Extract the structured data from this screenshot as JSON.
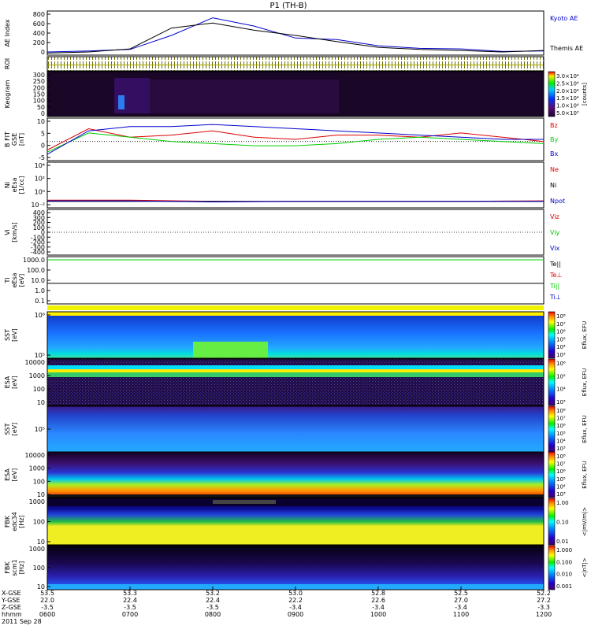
{
  "title": "P1 (TH-B)",
  "colors": {
    "frame": "#000000",
    "black": "#000000",
    "red": "#dd0000",
    "green": "#00cc00",
    "blue": "#0000cc",
    "yellow": "#f2f200",
    "navy": "#00007a"
  },
  "panels": [
    {
      "name": "ae-index",
      "ylabel": [
        "AE Index"
      ],
      "ticks": [
        "800",
        "600",
        "400",
        "200",
        "0"
      ],
      "right": [
        {
          "text": "Kyoto AE",
          "color": "blue"
        },
        {
          "text": "Themis AE",
          "color": "black"
        }
      ]
    },
    {
      "name": "roi",
      "ylabel": [
        "ROI"
      ],
      "ticks": [],
      "right": []
    },
    {
      "name": "keogram",
      "ylabel": [
        "Keogram"
      ],
      "ticks": [
        "300",
        "250",
        "200",
        "150",
        "100",
        "50",
        "0"
      ],
      "right": []
    },
    {
      "name": "b-fit",
      "ylabel": [
        "B FIT",
        "GSE",
        "[nT]"
      ],
      "ticks": [
        "10",
        "5",
        "0",
        "-5"
      ],
      "right": [
        {
          "text": "Bz",
          "color": "red"
        },
        {
          "text": "By",
          "color": "green"
        },
        {
          "text": "Bx",
          "color": "blue"
        }
      ]
    },
    {
      "name": "density",
      "ylabel": [
        "Ni",
        "eEsa",
        "[1/cc]"
      ],
      "ticks": [
        "10⁴",
        "10²",
        "10⁰",
        "10⁻²"
      ],
      "right": [
        {
          "text": "Ne",
          "color": "red"
        },
        {
          "text": "Ni",
          "color": "black"
        },
        {
          "text": "Npot",
          "color": "blue"
        }
      ]
    },
    {
      "name": "velocity",
      "ylabel": [
        "Vi",
        "[km/s]"
      ],
      "ticks": [
        "400",
        "300",
        "200",
        "100",
        "0",
        "-100",
        "-200",
        "-300",
        "-400"
      ],
      "right": [
        {
          "text": "Viz",
          "color": "red"
        },
        {
          "text": "Viy",
          "color": "green"
        },
        {
          "text": "Vix",
          "color": "blue"
        }
      ]
    },
    {
      "name": "temperature",
      "ylabel": [
        "Ti",
        "eEsa",
        "[eV]"
      ],
      "ticks": [
        "1000.0",
        "100.0",
        "10.0",
        "1.0",
        "0.1"
      ],
      "right": [
        {
          "text": "Te||",
          "color": "black"
        },
        {
          "text": "Te⊥",
          "color": "red"
        },
        {
          "text": "Ti||",
          "color": "green"
        },
        {
          "text": "Ti⊥",
          "color": "blue"
        }
      ]
    },
    {
      "name": "sst-ion",
      "ylabel": [
        "SST",
        "[eV]"
      ],
      "ticks": [
        "10⁶",
        "10⁵"
      ],
      "right": []
    },
    {
      "name": "esa-ion",
      "ylabel": [
        "ESA",
        "[eV]"
      ],
      "ticks": [
        "10000",
        "1000",
        "100",
        "10"
      ],
      "right": []
    },
    {
      "name": "sst-elec",
      "ylabel": [
        "SST",
        "[eV]"
      ],
      "ticks": [
        "10⁵"
      ],
      "right": []
    },
    {
      "name": "esa-elec",
      "ylabel": [
        "ESA",
        "[eV]"
      ],
      "ticks": [
        "10000",
        "1000",
        "100",
        "10"
      ],
      "right": []
    },
    {
      "name": "fbk-edc34",
      "ylabel": [
        "FBK",
        "edc34",
        "[Hz]"
      ],
      "ticks": [
        "1000",
        "100",
        "10"
      ],
      "right": []
    },
    {
      "name": "fbk-scm",
      "ylabel": [
        "FBK",
        "scm1",
        "[Hz]"
      ],
      "ticks": [
        "1000",
        "100",
        "10"
      ],
      "right": []
    }
  ],
  "colorbars": [
    {
      "name": "keogram-colorbar",
      "ticks": [
        "3.0×10⁴",
        "2.5×10⁴",
        "2.0×10⁴",
        "1.5×10⁴",
        "1.0×10⁴",
        "5.0×10³"
      ],
      "unit": "[counts]"
    },
    {
      "name": "sst-ion-colorbar",
      "ticks": [
        "10⁸",
        "10⁷",
        "10⁶",
        "10⁵",
        "10⁴",
        "10³"
      ],
      "unit": "Eflux, EFU"
    },
    {
      "name": "esa-ion-colorbar",
      "ticks": [
        "10⁶",
        "10⁵",
        "10⁴",
        "10³"
      ],
      "unit": "Eflux, EFU"
    },
    {
      "name": "sst-elec-colorbar",
      "ticks": [
        "10⁸",
        "10⁷",
        "10⁶",
        "10⁵",
        "10⁴",
        "10³"
      ],
      "unit": "Eflux, EFU"
    },
    {
      "name": "esa-elec-colorbar",
      "ticks": [
        "10⁸",
        "10⁷",
        "10⁶",
        "10⁵",
        "10⁴",
        "10³"
      ],
      "unit": "Eflux, EFU"
    },
    {
      "name": "fbk-edc34-colorbar",
      "ticks": [
        "1.00",
        "0.10",
        "0.01"
      ],
      "unit": "<|mV/m|>"
    },
    {
      "name": "fbk-scm-colorbar",
      "ticks": [
        "1.000",
        "0.100",
        "0.010",
        "0.001"
      ],
      "unit": "<|nT|>"
    }
  ],
  "xaxis": {
    "rowlabels": [
      "X-GSE",
      "Y-GSE",
      "Z-GSE",
      "hhmm",
      "2011 Sep 28"
    ],
    "columns": [
      {
        "x": "53.5",
        "y": "22.0",
        "z": "-3.5",
        "t": "0600"
      },
      {
        "x": "53.3",
        "y": "22.4",
        "z": "-3.5",
        "t": "0700"
      },
      {
        "x": "53.2",
        "y": "22.4",
        "z": "-3.5",
        "t": "0800"
      },
      {
        "x": "53.0",
        "y": "22.2",
        "z": "-3.4",
        "t": "0900"
      },
      {
        "x": "52.8",
        "y": "22.6",
        "z": "-3.4",
        "t": "1000"
      },
      {
        "x": "52.5",
        "y": "27.0",
        "z": "-3.4",
        "t": "1100"
      },
      {
        "x": "52.2",
        "y": "27.2",
        "z": "-3.3",
        "t": "1200"
      }
    ]
  },
  "chart_data": [
    {
      "type": "line",
      "title": "P1 (TH-B)",
      "ylabel": "AE Index",
      "ylim": [
        0,
        850
      ],
      "x": [
        "0600",
        "0630",
        "0700",
        "0730",
        "0800",
        "0830",
        "0900",
        "0930",
        "1000",
        "1030",
        "1100",
        "1130",
        "1200"
      ],
      "series": [
        {
          "name": "Kyoto AE",
          "values": [
            60,
            80,
            110,
            380,
            720,
            560,
            330,
            300,
            180,
            130,
            120,
            70,
            80
          ]
        },
        {
          "name": "Themis AE",
          "values": [
            40,
            60,
            120,
            520,
            620,
            480,
            380,
            260,
            150,
            110,
            90,
            60,
            90
          ]
        }
      ]
    },
    {
      "type": "line",
      "ylabel": "B FIT GSE [nT]",
      "ylim": [
        -8,
        12
      ],
      "x": [
        "0600",
        "0630",
        "0700",
        "0730",
        "0800",
        "0830",
        "0900",
        "0930",
        "1000",
        "1030",
        "1100",
        "1130",
        "1200"
      ],
      "series": [
        {
          "name": "Bz",
          "values": [
            -3,
            7,
            3,
            4,
            6,
            3,
            2,
            4,
            4,
            3,
            5,
            3,
            1
          ]
        },
        {
          "name": "By",
          "values": [
            -4,
            5,
            3,
            1,
            0,
            -1,
            -1,
            0,
            2,
            3,
            2,
            1,
            0
          ]
        },
        {
          "name": "Bx",
          "values": [
            -5,
            6,
            8,
            8,
            9,
            8,
            7,
            6,
            5,
            4,
            3,
            2,
            2
          ]
        }
      ]
    },
    {
      "type": "line",
      "ylabel": "Ni eEsa [1/cc]",
      "ylim": [
        -2,
        5
      ],
      "yscale": "log",
      "x": [
        "0600",
        "0700",
        "0800",
        "0900",
        "1000",
        "1100",
        "1200"
      ],
      "series": [
        {
          "name": "Ne",
          "values": [
            0.15,
            0.15,
            0.1,
            0.1,
            0.1,
            0.1,
            0.12
          ]
        },
        {
          "name": "Ni",
          "values": [
            0.1,
            0.1,
            0.1,
            0.1,
            0.1,
            0.1,
            0.1
          ]
        },
        {
          "name": "Npot",
          "values": [
            0.12,
            0.12,
            0.08,
            0.1,
            0.1,
            0.1,
            0.1
          ]
        }
      ]
    },
    {
      "type": "line",
      "ylabel": "Ti eEsa [eV]",
      "yscale": "log",
      "x": [
        "0600",
        "0700",
        "0800",
        "0900",
        "1000",
        "1100",
        "1200"
      ],
      "series": [
        {
          "name": "Ti||",
          "values": [
            1000,
            1000,
            1000,
            1000,
            1000,
            1000,
            1000
          ]
        },
        {
          "name": "Te||",
          "values": [
            5,
            5,
            5,
            5,
            5,
            5,
            5
          ]
        }
      ]
    }
  ]
}
